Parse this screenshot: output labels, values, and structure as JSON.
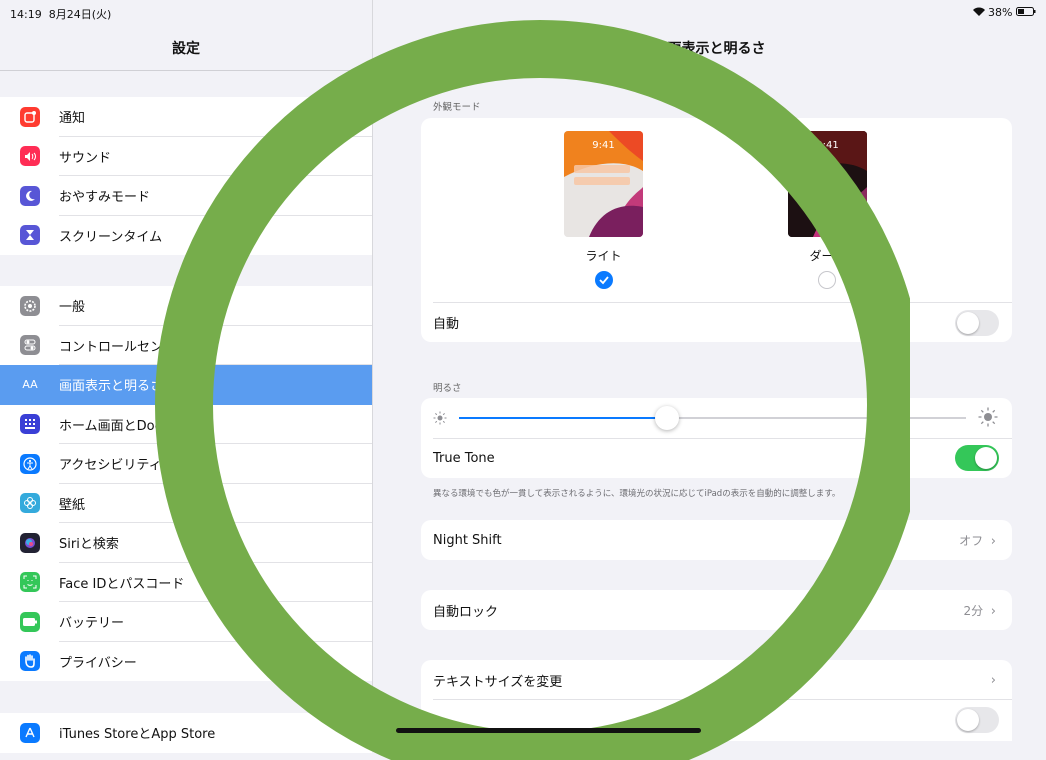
{
  "status": {
    "time": "14:19",
    "date": "8月24日(火)",
    "battery": "38%"
  },
  "sidebar": {
    "title": "設定",
    "groups": [
      {
        "items": [
          {
            "label": "通知",
            "icon": "bell-icon",
            "color": "#ff3b30"
          },
          {
            "label": "サウンド",
            "icon": "speaker-icon",
            "color": "#ff2d55"
          },
          {
            "label": "おやすみモード",
            "icon": "moon-icon",
            "color": "#5856d6"
          },
          {
            "label": "スクリーンタイム",
            "icon": "hourglass-icon",
            "color": "#5856d6"
          }
        ]
      },
      {
        "items": [
          {
            "label": "一般",
            "icon": "gear-icon",
            "color": "#8e8e93"
          },
          {
            "label": "コントロールセンター",
            "icon": "switches-icon",
            "color": "#8e8e93"
          },
          {
            "label": "画面表示と明るさ",
            "icon": "text-size-icon",
            "color": "#0a7aff",
            "selected": true
          },
          {
            "label": "ホーム画面とDock",
            "icon": "grid-icon",
            "color": "#3a3fd6"
          },
          {
            "label": "アクセシビリティ",
            "icon": "accessibility-icon",
            "color": "#0a7aff"
          },
          {
            "label": "壁紙",
            "icon": "flower-icon",
            "color": "#34aadc"
          },
          {
            "label": "Siriと検索",
            "icon": "siri-icon",
            "color": "#222233"
          },
          {
            "label": "Face IDとパスコード",
            "icon": "face-id-icon",
            "color": "#34c759"
          },
          {
            "label": "バッテリー",
            "icon": "battery-icon",
            "color": "#34c759"
          },
          {
            "label": "プライバシー",
            "icon": "hand-icon",
            "color": "#0a7aff"
          }
        ]
      },
      {
        "items": [
          {
            "label": "iTunes StoreとApp Store",
            "icon": "app-store-icon",
            "color": "#0a7aff"
          }
        ]
      }
    ]
  },
  "main": {
    "title": "画面表示と明るさ",
    "appearance": {
      "section_label": "外観モード",
      "light_label": "ライト",
      "dark_label": "ダーク",
      "preview_time": "9:41",
      "auto_label": "自動",
      "auto_on": false
    },
    "brightness": {
      "section_label": "明るさ",
      "level": 0.41,
      "true_tone_label": "True Tone",
      "true_tone_on": true,
      "footnote": "異なる環境でも色が一貫して表示されるように、環境光の状況に応じてiPadの表示を自動的に調整します。"
    },
    "night_shift": {
      "label": "Night Shift",
      "value": "オフ"
    },
    "auto_lock": {
      "label": "自動ロック",
      "value": "2分"
    },
    "text_size": {
      "label": "テキストサイズを変更"
    }
  },
  "colors": {
    "accent": "#0a7aff",
    "selected_row": "#5a9cf0",
    "toggle_on": "#34c759",
    "overlay_ring": "#76ad4b"
  }
}
